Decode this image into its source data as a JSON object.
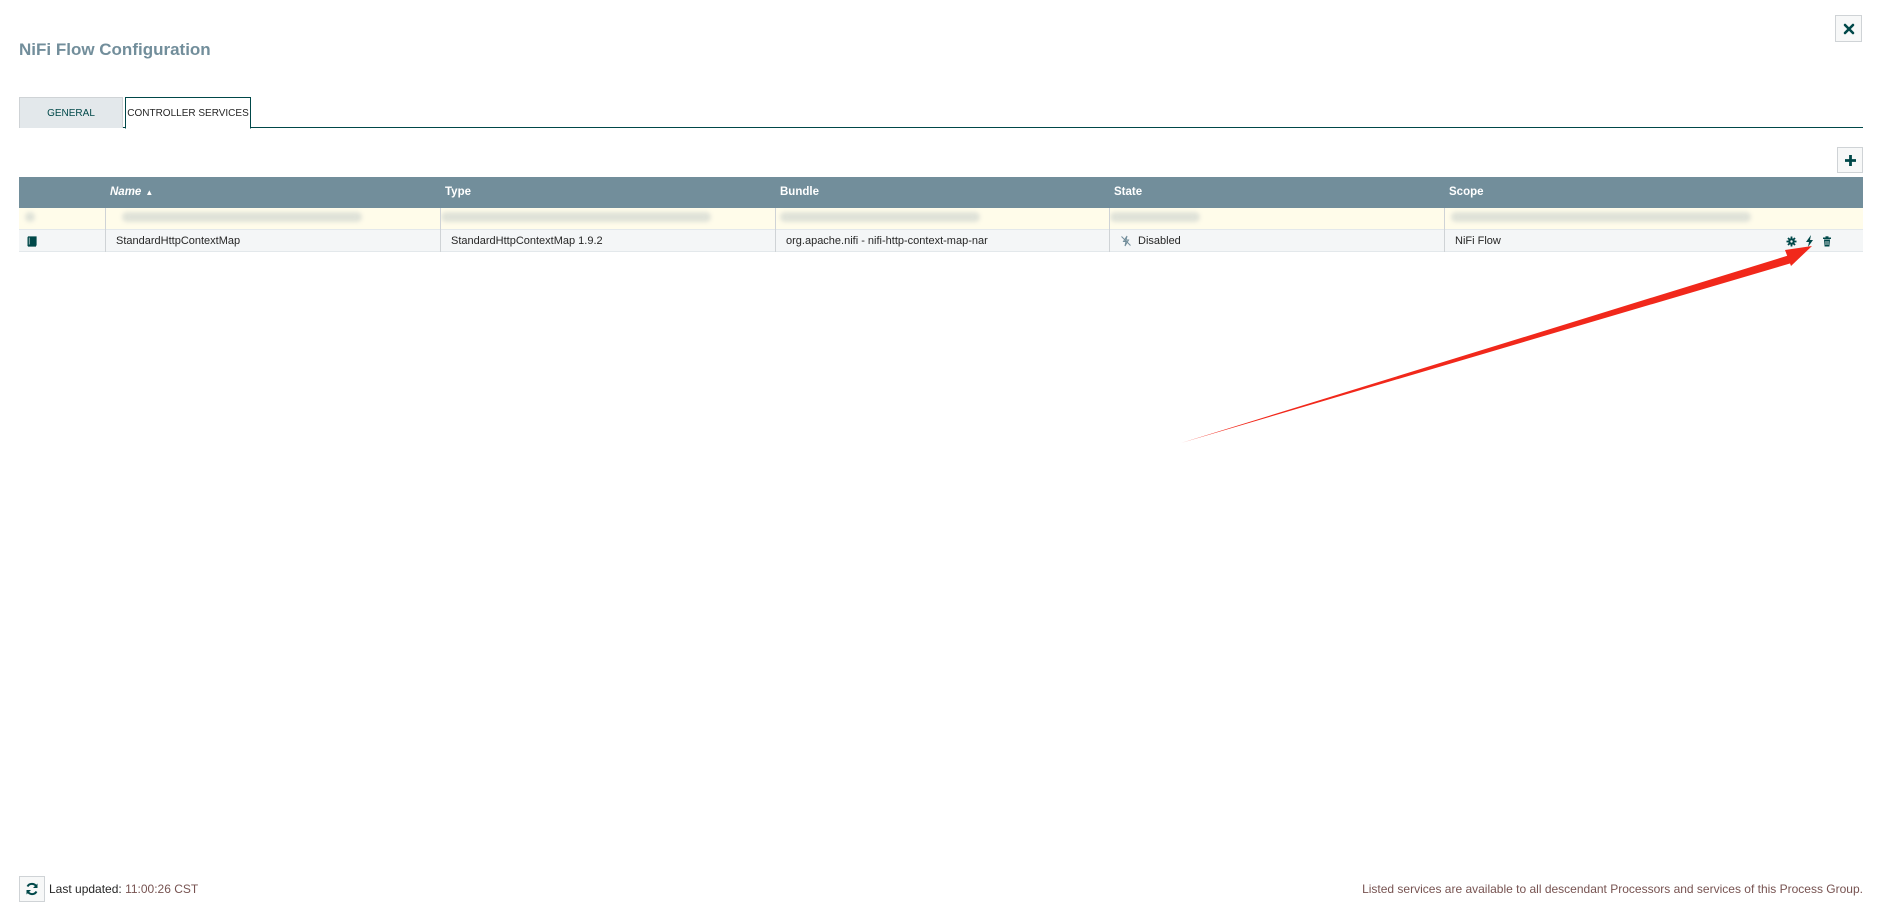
{
  "dialog": {
    "title": "NiFi Flow Configuration",
    "close_icon": "close-icon"
  },
  "tabs": [
    {
      "label": "GENERAL",
      "active": false
    },
    {
      "label": "CONTROLLER SERVICES",
      "active": true
    }
  ],
  "toolbar": {
    "add_icon": "plus-icon"
  },
  "table": {
    "columns": [
      {
        "label": "",
        "key": "icon"
      },
      {
        "label": "Name",
        "key": "name",
        "sorted": "ascending"
      },
      {
        "label": "Type",
        "key": "type"
      },
      {
        "label": "Bundle",
        "key": "bundle"
      },
      {
        "label": "State",
        "key": "state"
      },
      {
        "label": "Scope",
        "key": "scope"
      },
      {
        "label": "",
        "key": "actions"
      }
    ],
    "sort_indicator": "▲",
    "rows": [
      {
        "redacted": true,
        "name": "",
        "type": "",
        "bundle": "",
        "state": "",
        "scope": ""
      },
      {
        "redacted": false,
        "row_icon": "book-icon",
        "name": "StandardHttpContextMap",
        "type": "StandardHttpContextMap 1.9.2",
        "bundle": "org.apache.nifi - nifi-http-context-map-nar",
        "state": "Disabled",
        "state_icon": "disabled-icon",
        "scope": "NiFi Flow",
        "actions": [
          "gear-icon",
          "lightning-icon",
          "trash-icon"
        ]
      }
    ]
  },
  "footer": {
    "refresh_icon": "refresh-icon",
    "last_updated_label": "Last updated:",
    "last_updated_time": "11:00:26 CST",
    "note": "Listed services are available to all descendant Processors and services of this Process Group."
  },
  "colors": {
    "header": "#728e9b",
    "accent": "#004849",
    "annotation_arrow": "#f1281b"
  }
}
